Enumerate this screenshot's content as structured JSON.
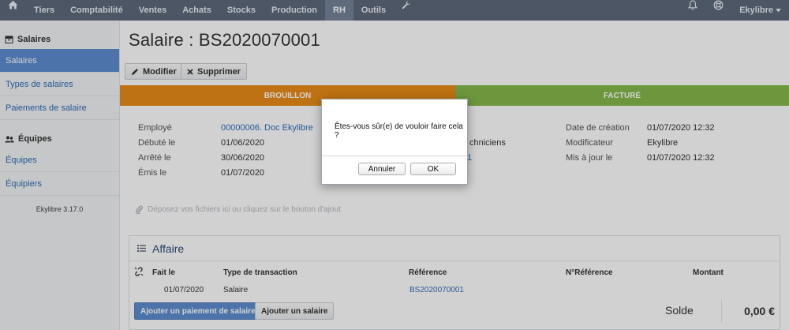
{
  "nav": {
    "items": [
      "Tiers",
      "Comptabilité",
      "Ventes",
      "Achats",
      "Stocks",
      "Production",
      "RH",
      "Outils"
    ],
    "active": "RH",
    "user": "Ekylibre"
  },
  "sidebar": {
    "section1_title": "Salaires",
    "section1_items": [
      "Salaires",
      "Types de salaires",
      "Paiements de salaire"
    ],
    "section2_title": "Équipes",
    "section2_items": [
      "Équipes",
      "Équipiers"
    ],
    "version": "Ekylibre 3.17.0"
  },
  "page": {
    "title": "Salaire : BS2020070001",
    "modify_label": "Modifier",
    "delete_label": "Supprimer"
  },
  "status": {
    "left": "BROUILLON",
    "right": "FACTURÉ"
  },
  "fields": {
    "employee_label": "Employé",
    "employee_value": "00000006. Doc Ekylibre",
    "started_label": "Débuté le",
    "started_value": "01/06/2020",
    "stopped_label": "Arrêté le",
    "stopped_value": "30/06/2020",
    "emitted_label": "Émis le",
    "emitted_value": "01/07/2020",
    "partial_team": "chniciens",
    "partial_link": "1",
    "created_label": "Date de création",
    "created_value": "01/07/2020 12:32",
    "modifier_label": "Modificateur",
    "modifier_value": "Ekylibre",
    "updated_label": "Mis à jour le",
    "updated_value": "01/07/2020 12:32"
  },
  "dropzone": "Déposez vos fichiers ici ou cliquez sur le bouton d'ajout",
  "affaire": {
    "title": "Affaire",
    "columns": [
      "Fait le",
      "Type de transaction",
      "Référence",
      "N°Référence",
      "Montant"
    ],
    "row": {
      "date": "01/07/2020",
      "type": "Salaire",
      "reference": "BS2020070001"
    },
    "add_payment": "Ajouter un paiement de salaire",
    "add_salary": "Ajouter un salaire",
    "balance_label": "Solde",
    "balance_value": "0,00 €"
  },
  "dialog": {
    "message": "Êtes-vous sûr(e) de vouloir faire cela ?",
    "cancel": "Annuler",
    "ok": "OK"
  },
  "colors": {
    "nav": "#5d6a7c",
    "draft": "#e98b18",
    "invoiced": "#84b94a",
    "link": "#2c6eb5",
    "active": "#5d8ed0"
  }
}
